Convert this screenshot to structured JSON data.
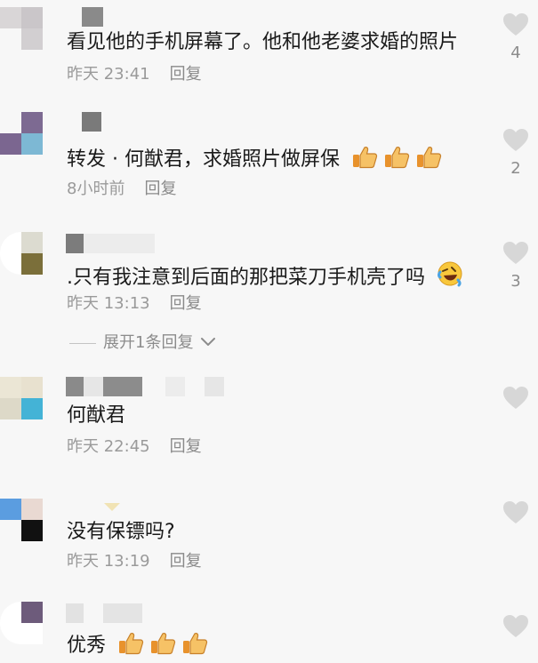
{
  "comments": [
    {
      "text": "看见他的手机屏幕了。他和他老婆求婚的照片",
      "time": "昨天 23:41",
      "reply": "回复",
      "likes": "4"
    },
    {
      "text": "转发 · 何猷君，求婚照片做屏保",
      "time": "8小时前",
      "reply": "回复",
      "likes": "2",
      "emoji": [
        "thumbs-up-icon",
        "thumbs-up-icon",
        "thumbs-up-icon"
      ]
    },
    {
      "text": ".只有我注意到后面的那把菜刀手机壳了吗",
      "time": "昨天 13:13",
      "reply": "回复",
      "likes": "3",
      "emoji": [
        "rolling-laugh-icon"
      ],
      "expand_label": "展开1条回复"
    },
    {
      "text": "何猷君",
      "time": "昨天 22:45",
      "reply": "回复"
    },
    {
      "text": "没有保镖吗?",
      "time": "昨天 13:19",
      "reply": "回复"
    },
    {
      "text": "优秀",
      "emoji": [
        "thumbs-up-icon",
        "thumbs-up-icon",
        "thumbs-up-icon"
      ]
    }
  ],
  "colors": {
    "background": "#f7f7f7",
    "text": "#1a1a1a",
    "meta": "#9a9a9a",
    "heart": "#d7d7d7"
  }
}
